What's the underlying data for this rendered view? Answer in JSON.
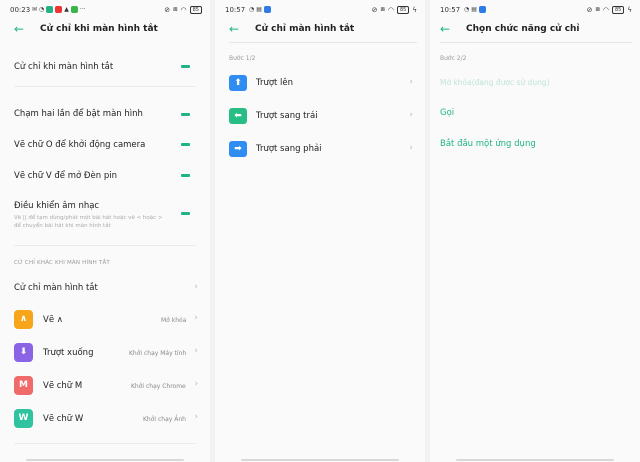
{
  "panel1": {
    "status": {
      "time": "00:23",
      "battery": "85"
    },
    "title": "Cử chỉ khi màn hình tắt",
    "main_toggle": "Cử chỉ khi màn hình tắt",
    "toggles": [
      "Chạm hai lần để bật màn hình",
      "Vẽ chữ O để khởi động camera",
      "Vẽ chữ V để mở Đèn pin",
      "Điều khiển âm nhạc"
    ],
    "music_desc": "Vẽ || để tạm dừng/phát một bài hát hoặc vẽ < hoặc > để chuyển bài hát khi màn hình tắt",
    "section_title": "CỬ CHỈ KHÁC KHI MÀN HÌNH TẮT",
    "screen_off_gesture": "Cử chỉ màn hình tắt",
    "gestures": [
      {
        "icon": "∧",
        "label": "Vẽ ∧",
        "value": "Mở khóa",
        "color": "#f7a51b"
      },
      {
        "icon": "⬇",
        "label": "Trượt xuống",
        "value": "Khởi chạy Máy tính",
        "color": "#8b64e6"
      },
      {
        "icon": "M",
        "label": "Vẽ chữ M",
        "value": "Khởi chạy Chrome",
        "color": "#f06a6a"
      },
      {
        "icon": "W",
        "label": "Vẽ chữ W",
        "value": "Khởi chạy Ảnh",
        "color": "#2fc3a0"
      }
    ]
  },
  "panel2": {
    "status": {
      "time": "10:57",
      "battery": "85"
    },
    "title": "Cử chỉ màn hình tắt",
    "step": "Bước 1/2",
    "directions": [
      {
        "icon": "⬆",
        "label": "Trượt lên",
        "color": "#2f8cf0"
      },
      {
        "icon": "⬅",
        "label": "Trượt sang trái",
        "color": "#27be86"
      },
      {
        "icon": "➡",
        "label": "Trượt sang phải",
        "color": "#2f8cf0"
      }
    ]
  },
  "panel3": {
    "status": {
      "time": "10:57",
      "battery": "85"
    },
    "title": "Chọn chức năng cử chỉ",
    "step": "Bước 2/2",
    "options": [
      "Mở khóa(đang được sử dụng)",
      "Gọi",
      "Bắt đầu một ứng dụng"
    ]
  },
  "colors": {
    "accent": "#1eb488"
  }
}
